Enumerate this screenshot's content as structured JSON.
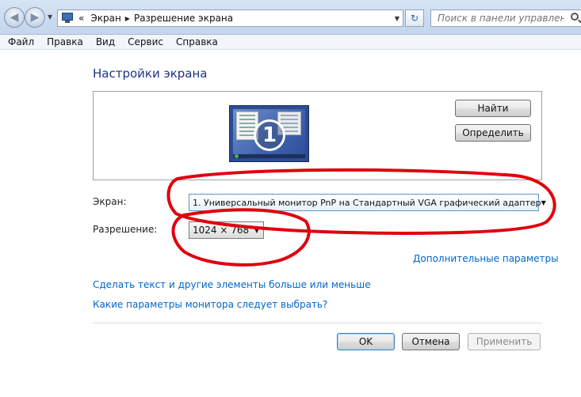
{
  "window": {
    "breadcrumb": [
      "Экран",
      "Разрешение экрана"
    ],
    "breadcrumb_prefix": "«",
    "search_placeholder": "Поиск в панели управления"
  },
  "menu": [
    "Файл",
    "Правка",
    "Вид",
    "Сервис",
    "Справка"
  ],
  "page": {
    "title": "Настройки экрана",
    "monitor_number": "1",
    "find_button": "Найти",
    "identify_button": "Определить",
    "screen_label": "Экран:",
    "screen_value": "1. Универсальный монитор PnP на Стандартный VGA графический адаптер",
    "resolution_label": "Разрешение:",
    "resolution_value": "1024 × 768",
    "advanced_link": "Дополнительные параметры",
    "text_size_link": "Сделать текст и другие элементы больше или меньше",
    "which_settings_link": "Какие параметры монитора следует выбрать?",
    "ok_button": "OK",
    "cancel_button": "Отмена",
    "apply_button": "Применить"
  },
  "colors": {
    "title": "#1e3287",
    "link": "#0066cc",
    "annotation": "#e0000e"
  }
}
